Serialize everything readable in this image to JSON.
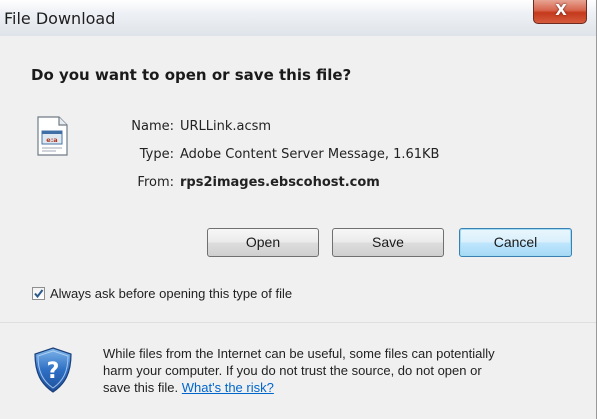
{
  "window": {
    "title": "File Download",
    "close_glyph": "X"
  },
  "dialog": {
    "question": "Do you want to open or save this file?",
    "file_icon": "document-icon",
    "fields": [
      {
        "label": "Name:",
        "value": "URLLink.acsm",
        "bold": false
      },
      {
        "label": "Type:",
        "value": "Adobe Content Server Message, 1.61KB",
        "bold": false
      },
      {
        "label": "From:",
        "value": "rps2images.ebscohost.com",
        "bold": true
      }
    ],
    "buttons": {
      "open": "Open",
      "save": "Save",
      "cancel": "Cancel"
    },
    "always_ask": {
      "checked": true,
      "label": "Always ask before opening this type of file"
    }
  },
  "footer": {
    "icon": "shield-question-icon",
    "warning_line1": "While files from the Internet can be useful, some files can potentially",
    "warning_line2": "harm your computer. If you do not trust the source, do not open or",
    "warning_line3": "save this file.",
    "risk_link": "What's the risk?"
  },
  "colors": {
    "link": "#0066cc",
    "close_button": "#c4391c",
    "default_button_border": "#3c7fb1"
  }
}
